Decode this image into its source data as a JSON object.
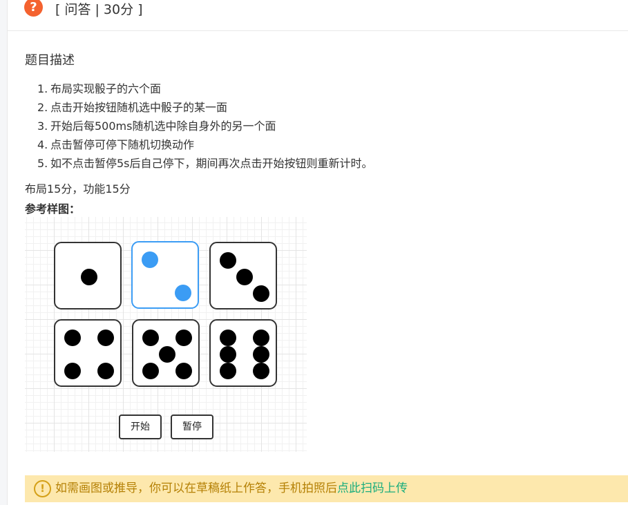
{
  "question": {
    "type_label": "[ 问答 | 30分 ]",
    "icon": "question-mark-icon",
    "icon_glyph": "?",
    "accent_color": "#f4622f"
  },
  "description": {
    "title": "题目描述",
    "requirements": [
      {
        "num": "1.",
        "text": "布局实现骰子的六个面"
      },
      {
        "num": "2.",
        "text": "点击开始按钮随机选中骰子的某一面"
      },
      {
        "num": "3.",
        "text": "开始后每500ms随机选中除自身外的另一个面"
      },
      {
        "num": "4.",
        "text": "点击暂停可停下随机切换动作"
      },
      {
        "num": "5.",
        "text": "如不点击暂停5s后自己停下，期间再次点击开始按钮则重新计时。"
      }
    ],
    "score_breakdown": "布局15分，功能15分",
    "reference_title": "参考样图："
  },
  "sample_figure": {
    "selected_face": 2,
    "selected_color": "#3b9cf4",
    "pip_color": "#000000",
    "faces": [
      {
        "value": 1
      },
      {
        "value": 2
      },
      {
        "value": 3
      },
      {
        "value": 4
      },
      {
        "value": 5
      },
      {
        "value": 6
      }
    ],
    "buttons": {
      "start_label": "开始",
      "pause_label": "暂停"
    }
  },
  "tip": {
    "icon": "exclamation-circle-icon",
    "icon_glyph": "!",
    "text": "如需画图或推导，你可以在草稿纸上作答，手机拍照后",
    "link_text": "点此扫码上传",
    "text_color": "#b58106",
    "link_color": "#1aad7d",
    "background": "#fde8ad"
  }
}
